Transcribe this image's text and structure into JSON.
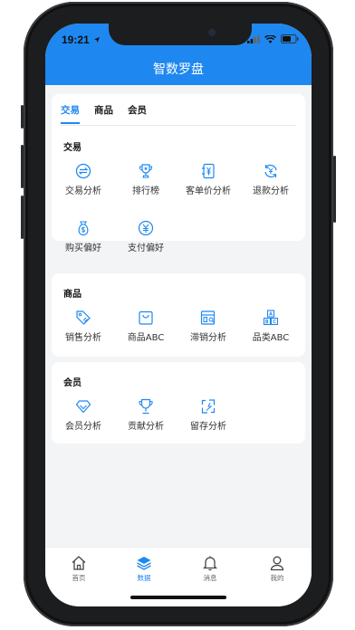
{
  "status_bar": {
    "time": "19:21"
  },
  "header": {
    "title": "智数罗盘"
  },
  "tabs": [
    {
      "label": "交易",
      "active": true
    },
    {
      "label": "商品",
      "active": false
    },
    {
      "label": "会员",
      "active": false
    }
  ],
  "sections": {
    "trade": {
      "title": "交易",
      "items": [
        {
          "label": "交易分析",
          "icon": "exchange-icon"
        },
        {
          "label": "排行榜",
          "icon": "trophy-icon"
        },
        {
          "label": "客单价分析",
          "icon": "price-tag-icon"
        },
        {
          "label": "退款分析",
          "icon": "refund-icon"
        },
        {
          "label": "购买偏好",
          "icon": "money-bag-icon"
        },
        {
          "label": "支付偏好",
          "icon": "yuan-icon"
        }
      ]
    },
    "goods": {
      "title": "商品",
      "items": [
        {
          "label": "销售分析",
          "icon": "sale-tag-icon"
        },
        {
          "label": "商品ABC",
          "icon": "shopping-bag-icon"
        },
        {
          "label": "滞销分析",
          "icon": "stock-search-icon"
        },
        {
          "label": "品类ABC",
          "icon": "abc-blocks-icon"
        }
      ]
    },
    "member": {
      "title": "会员",
      "items": [
        {
          "label": "会员分析",
          "icon": "diamond-icon"
        },
        {
          "label": "贡献分析",
          "icon": "cup-icon"
        },
        {
          "label": "留存分析",
          "icon": "retention-icon"
        }
      ]
    }
  },
  "tab_bar": [
    {
      "label": "首页",
      "icon": "home-icon",
      "active": false
    },
    {
      "label": "数据",
      "icon": "layers-icon",
      "active": true
    },
    {
      "label": "消息",
      "icon": "bell-icon",
      "active": false
    },
    {
      "label": "我的",
      "icon": "user-icon",
      "active": false
    }
  ],
  "colors": {
    "accent": "#1e88f0",
    "background": "#f3f4f6"
  }
}
